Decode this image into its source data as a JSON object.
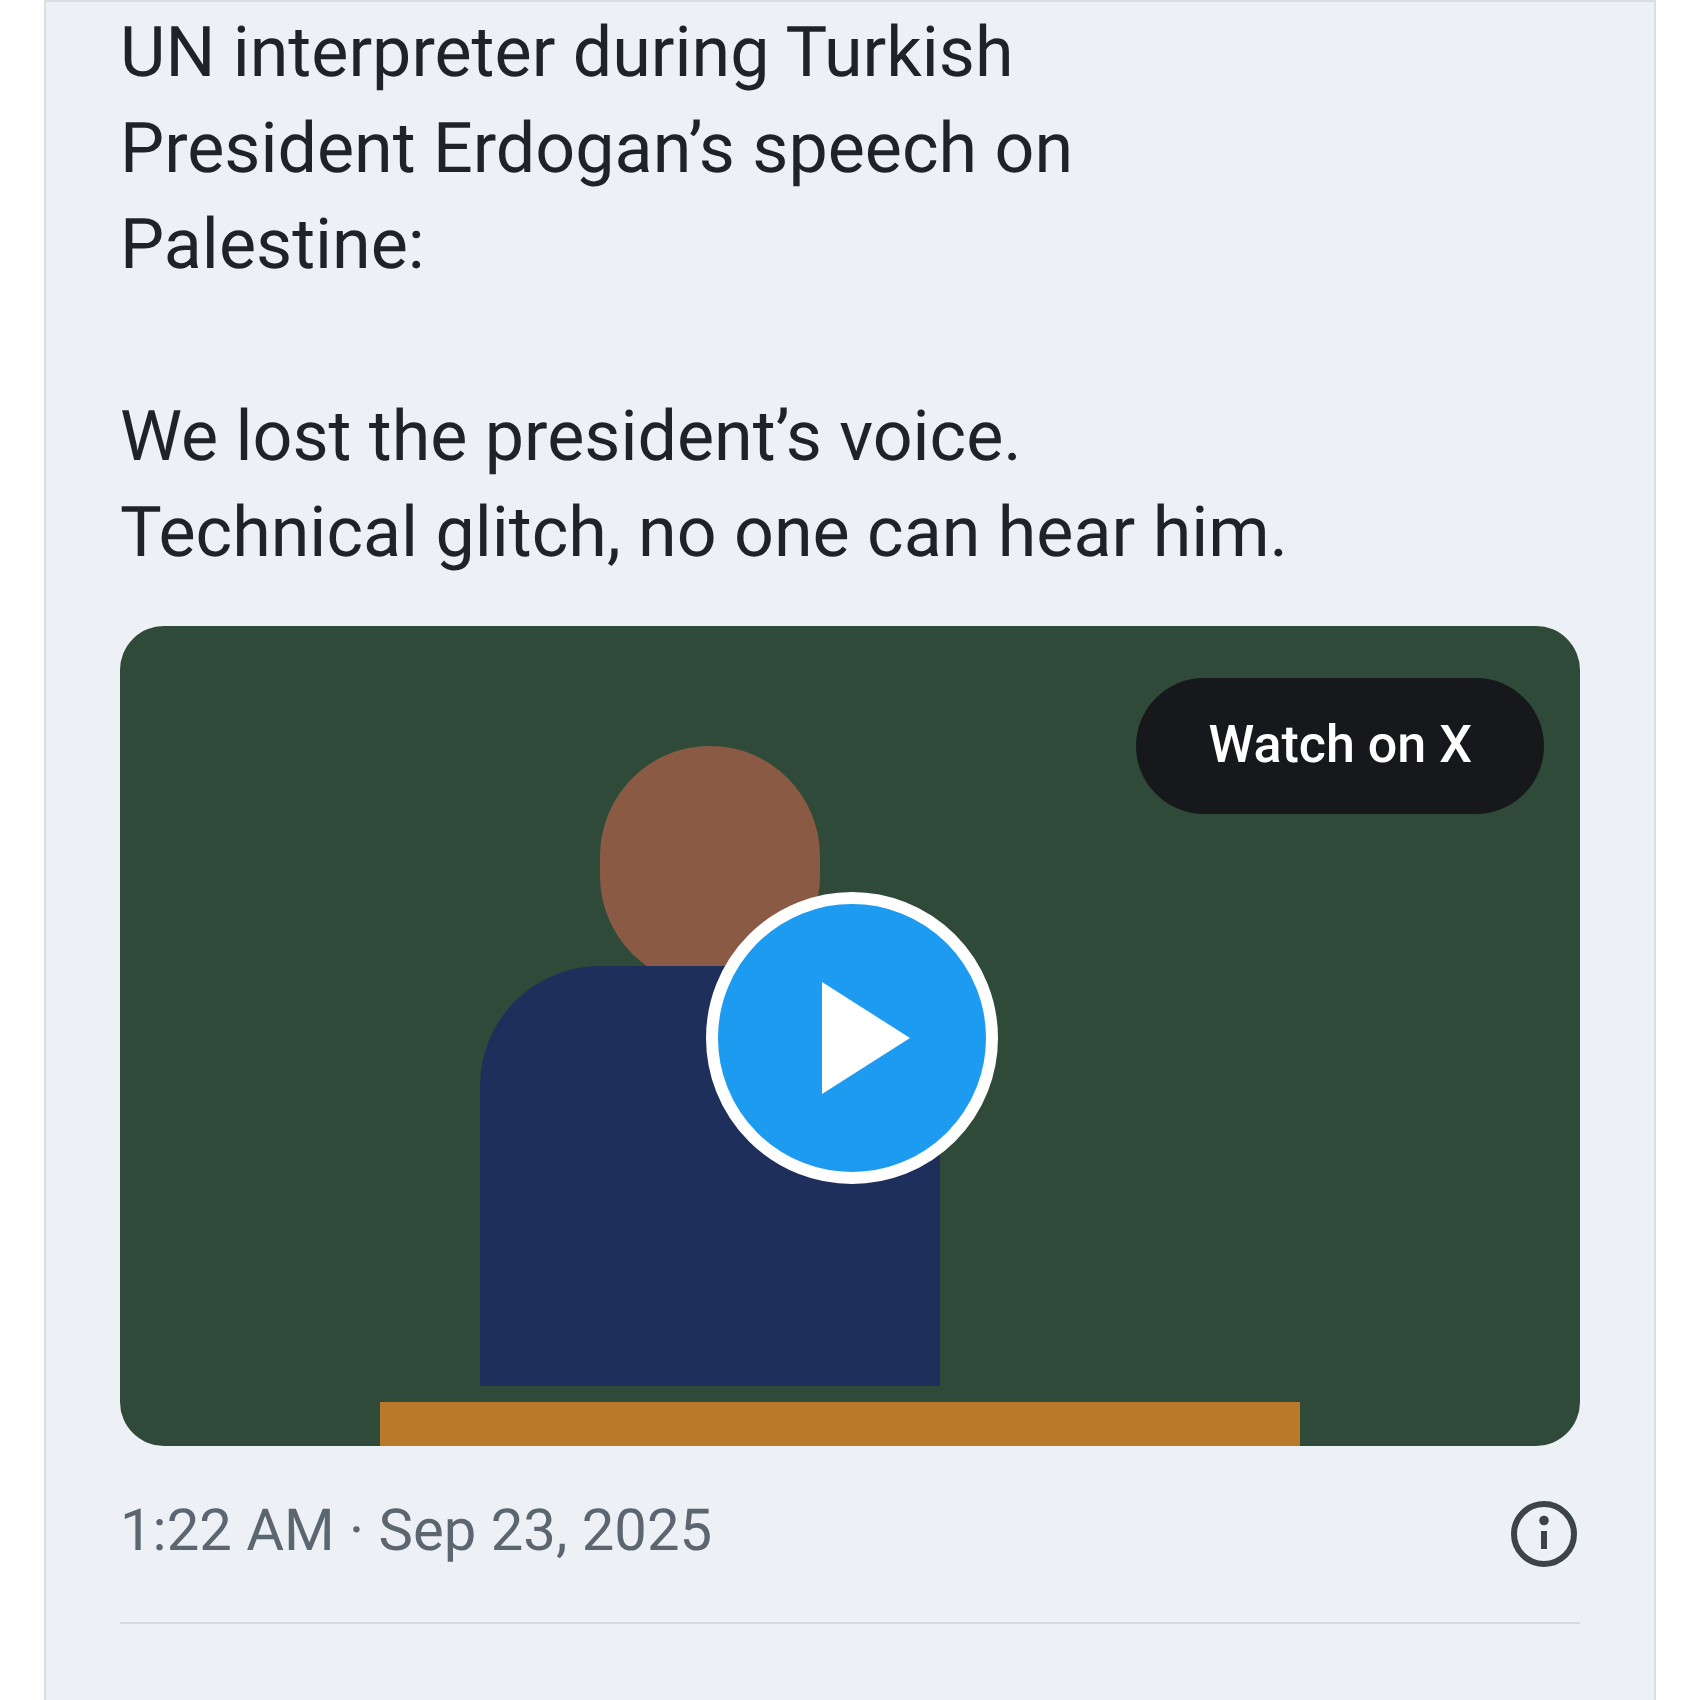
{
  "tweet": {
    "paragraphs": [
      [
        "UN interpreter during Turkish",
        "President Erdogan’s speech on",
        "Palestine:"
      ],
      [
        "We lost the president’s voice.",
        "Technical glitch, no one can hear him."
      ]
    ],
    "video": {
      "button": "Watch on X"
    },
    "timestamp": "1:22 AM · Sep 23, 2025"
  }
}
